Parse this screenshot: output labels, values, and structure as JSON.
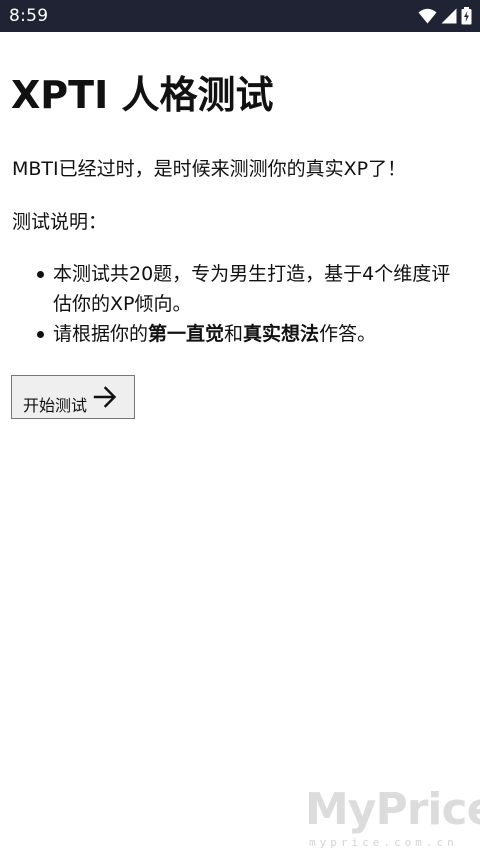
{
  "status_bar": {
    "time": "8:59",
    "icons": [
      "wifi-icon",
      "cellular-signal-icon",
      "battery-icon"
    ],
    "background": "#1f2333"
  },
  "page": {
    "title": "XPTI 人格测试",
    "intro": "MBTI已经过时，是时候来测测你的真实XP了！",
    "instructions_heading": "测试说明：",
    "rules": [
      {
        "text": "本测试共20题，专为男生打造，基于4个维度评估你的XP倾向。"
      },
      {
        "prefix": "请根据你的",
        "bold_1": "第一直觉",
        "middle": "和",
        "bold_2": "真实想法",
        "suffix": "作答。"
      }
    ]
  },
  "start_button": {
    "label": "开始测试",
    "icon": "arrow-right-icon"
  },
  "watermark": {
    "logo": "MyPrice",
    "url": "myprice.com.cn"
  }
}
